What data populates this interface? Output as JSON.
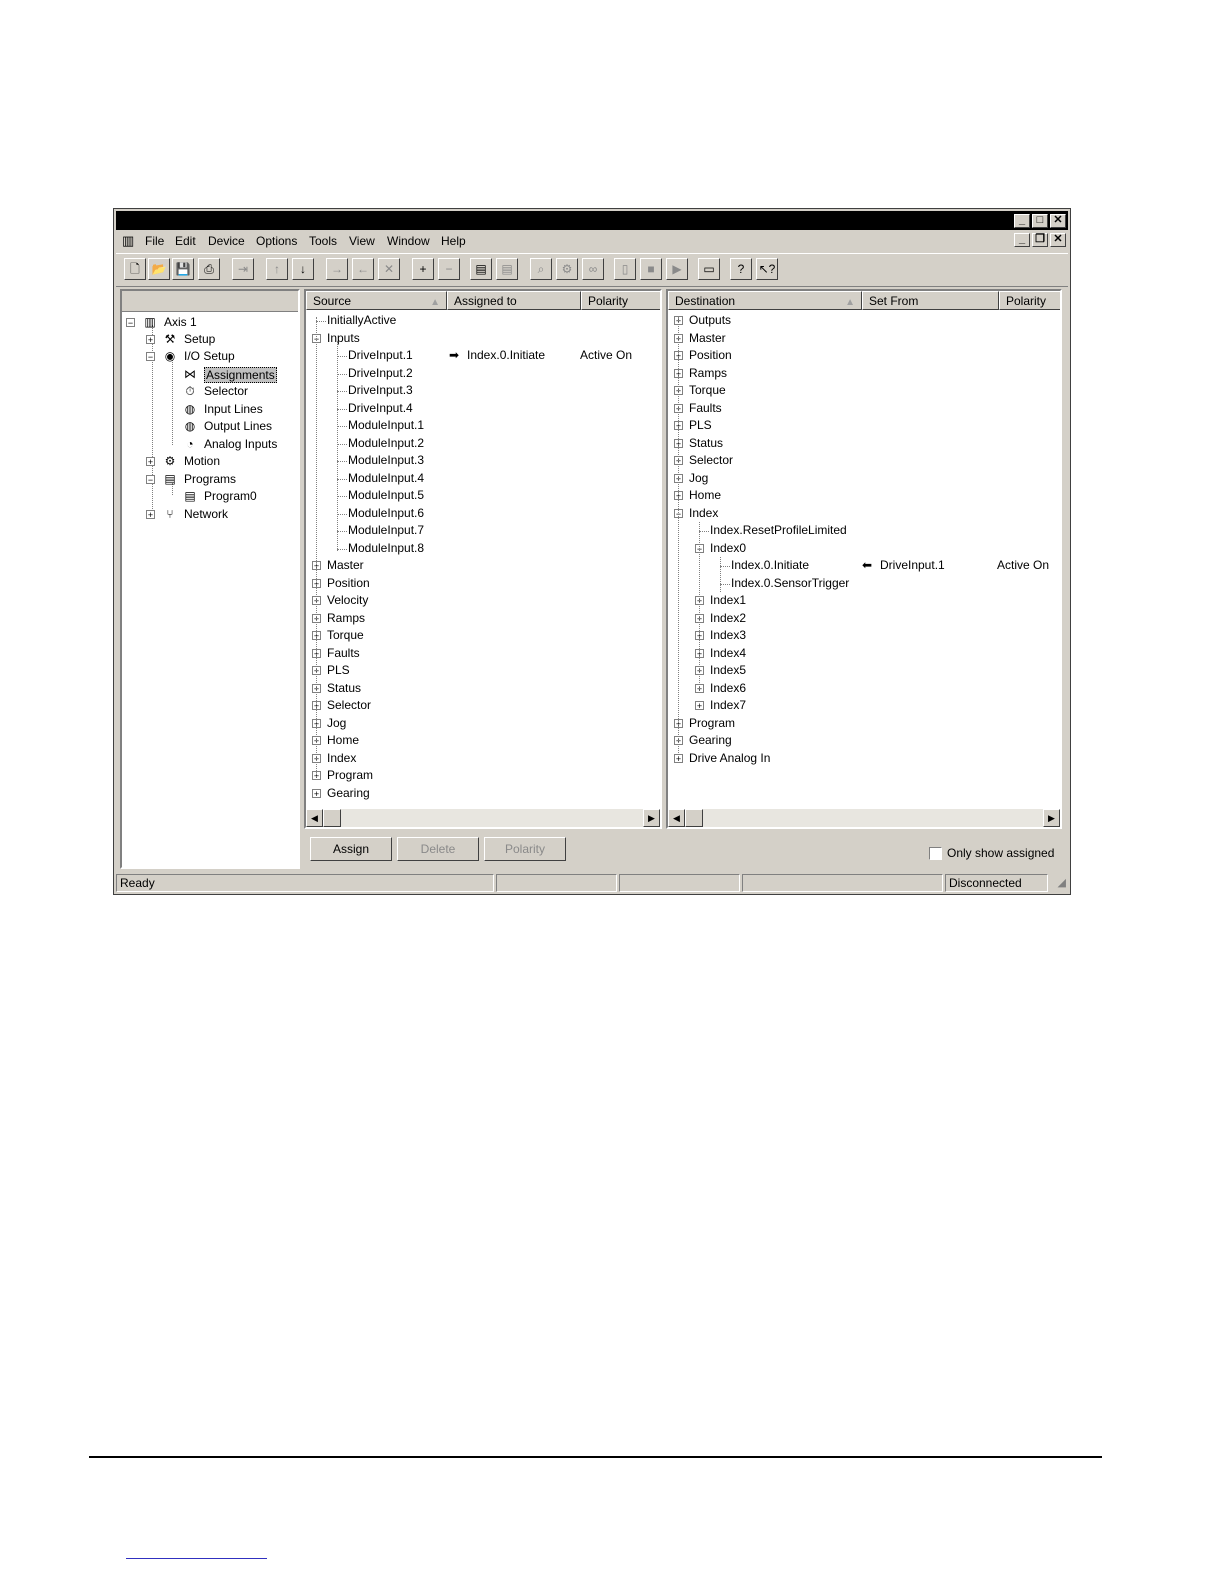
{
  "menubar": {
    "items": [
      "File",
      "Edit",
      "Device",
      "Options",
      "Tools",
      "View",
      "Window",
      "Help"
    ]
  },
  "toolbar": {
    "icons": [
      "new-icon",
      "open-icon",
      "save-icon",
      "print-icon",
      "import-icon",
      "upload-icon",
      "download-icon",
      "assign-right-icon",
      "assign-left-icon",
      "delete-icon",
      "add-icon",
      "remove-icon",
      "copy-icon",
      "paste-icon",
      "zoom-icon",
      "settings-icon",
      "glasses-icon",
      "drive-icon",
      "stop-icon",
      "run-icon",
      "window-icon",
      "help-icon",
      "context-help-icon"
    ]
  },
  "nav_tree": {
    "items": [
      {
        "label": "Axis 1",
        "icon": "axis-icon",
        "expander": "−"
      },
      {
        "label": "Setup",
        "icon": "setup-icon",
        "expander": "+"
      },
      {
        "label": "I/O Setup",
        "icon": "io-setup-icon",
        "expander": "−"
      },
      {
        "label": "Assignments",
        "icon": "assignments-icon",
        "selected": true
      },
      {
        "label": "Selector",
        "icon": "selector-icon"
      },
      {
        "label": "Input Lines",
        "icon": "input-lines-icon"
      },
      {
        "label": "Output Lines",
        "icon": "output-lines-icon"
      },
      {
        "label": "Analog Inputs",
        "icon": "analog-inputs-icon"
      },
      {
        "label": "Motion",
        "icon": "motion-icon",
        "expander": "+"
      },
      {
        "label": "Programs",
        "icon": "programs-icon",
        "expander": "−"
      },
      {
        "label": "Program0",
        "icon": "program-icon"
      },
      {
        "label": "Network",
        "icon": "network-icon",
        "expander": "+"
      }
    ]
  },
  "source_panel": {
    "columns": [
      "Source",
      "Assigned to",
      "Polarity"
    ],
    "rows": [
      {
        "label": "InitiallyActive"
      },
      {
        "label": "Inputs",
        "expander": "−"
      },
      {
        "label": "DriveInput.1",
        "assigned": "Index.0.Initiate",
        "polarity": "Active On"
      },
      {
        "label": "DriveInput.2"
      },
      {
        "label": "DriveInput.3"
      },
      {
        "label": "DriveInput.4"
      },
      {
        "label": "ModuleInput.1"
      },
      {
        "label": "ModuleInput.2"
      },
      {
        "label": "ModuleInput.3"
      },
      {
        "label": "ModuleInput.4"
      },
      {
        "label": "ModuleInput.5"
      },
      {
        "label": "ModuleInput.6"
      },
      {
        "label": "ModuleInput.7"
      },
      {
        "label": "ModuleInput.8"
      },
      {
        "label": "Master",
        "expander": "+"
      },
      {
        "label": "Position",
        "expander": "+"
      },
      {
        "label": "Velocity",
        "expander": "+"
      },
      {
        "label": "Ramps",
        "expander": "+"
      },
      {
        "label": "Torque",
        "expander": "+"
      },
      {
        "label": "Faults",
        "expander": "+"
      },
      {
        "label": "PLS",
        "expander": "+"
      },
      {
        "label": "Status",
        "expander": "+"
      },
      {
        "label": "Selector",
        "expander": "+"
      },
      {
        "label": "Jog",
        "expander": "+"
      },
      {
        "label": "Home",
        "expander": "+"
      },
      {
        "label": "Index",
        "expander": "+"
      },
      {
        "label": "Program",
        "expander": "+"
      },
      {
        "label": "Gearing",
        "expander": "+"
      }
    ]
  },
  "destination_panel": {
    "columns": [
      "Destination",
      "Set From",
      "Polarity"
    ],
    "rows": [
      {
        "label": "Outputs",
        "expander": "+"
      },
      {
        "label": "Master",
        "expander": "+"
      },
      {
        "label": "Position",
        "expander": "+"
      },
      {
        "label": "Ramps",
        "expander": "+"
      },
      {
        "label": "Torque",
        "expander": "+"
      },
      {
        "label": "Faults",
        "expander": "+"
      },
      {
        "label": "PLS",
        "expander": "+"
      },
      {
        "label": "Status",
        "expander": "+"
      },
      {
        "label": "Selector",
        "expander": "+"
      },
      {
        "label": "Jog",
        "expander": "+"
      },
      {
        "label": "Home",
        "expander": "+"
      },
      {
        "label": "Index",
        "expander": "−"
      },
      {
        "label": "Index.ResetProfileLimited"
      },
      {
        "label": "Index0",
        "expander": "−"
      },
      {
        "label": "Index.0.Initiate",
        "set_from": "DriveInput.1",
        "polarity": "Active On"
      },
      {
        "label": "Index.0.SensorTrigger"
      },
      {
        "label": "Index1",
        "expander": "+"
      },
      {
        "label": "Index2",
        "expander": "+"
      },
      {
        "label": "Index3",
        "expander": "+"
      },
      {
        "label": "Index4",
        "expander": "+"
      },
      {
        "label": "Index5",
        "expander": "+"
      },
      {
        "label": "Index6",
        "expander": "+"
      },
      {
        "label": "Index7",
        "expander": "+"
      },
      {
        "label": "Program",
        "expander": "+"
      },
      {
        "label": "Gearing",
        "expander": "+"
      },
      {
        "label": "Drive Analog In",
        "expander": "+"
      }
    ]
  },
  "buttons": {
    "assign": "Assign",
    "delete": "Delete",
    "polarity": "Polarity"
  },
  "only_show_assigned": {
    "label": "Only show assigned",
    "checked": false
  },
  "statusbar": {
    "status": "Ready",
    "connection": "Disconnected"
  }
}
